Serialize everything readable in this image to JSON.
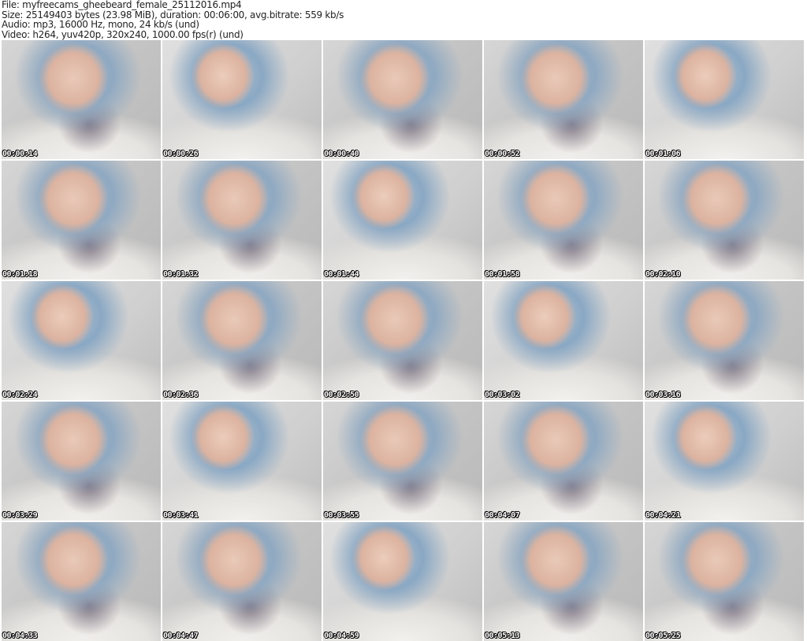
{
  "info": {
    "file": "File: myfreecams_gheebeard_female_25112016.mp4",
    "size": "Size: 25149403 bytes (23.98 MiB), duration: 00:06:00, avg.bitrate: 559 kb/s",
    "audio": "Audio: mp3, 16000 Hz, mono, 24 kb/s (und)",
    "video": "Video: h264, yuv420p, 320x240, 1000.00 fps(r) (und)"
  },
  "thumbnails": [
    "00:00:14",
    "00:00:26",
    "00:00:40",
    "00:00:52",
    "00:01:06",
    "00:01:18",
    "00:01:32",
    "00:01:44",
    "00:01:58",
    "00:02:10",
    "00:02:24",
    "00:02:36",
    "00:02:50",
    "00:03:02",
    "00:03:16",
    "00:03:29",
    "00:03:41",
    "00:03:55",
    "00:04:07",
    "00:04:21",
    "00:04:33",
    "00:04:47",
    "00:04:59",
    "00:05:13",
    "00:05:25"
  ]
}
